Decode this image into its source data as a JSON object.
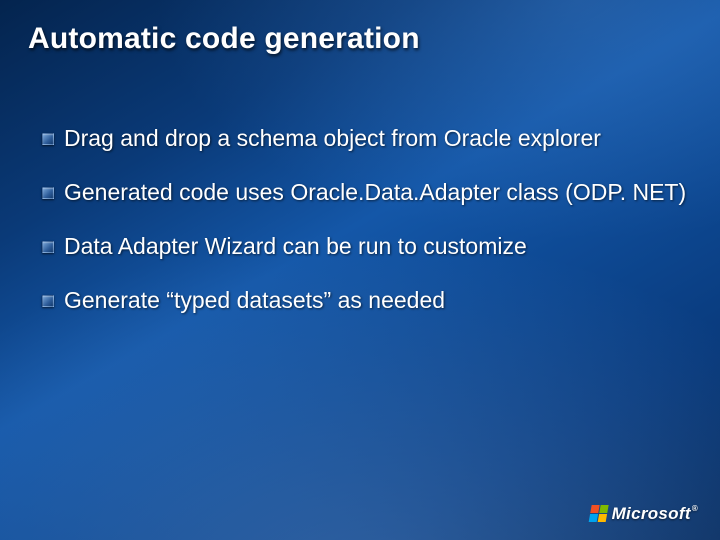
{
  "slide": {
    "title": "Automatic code generation",
    "bullets": [
      "Drag and drop a schema object from Oracle explorer",
      "Generated code uses Oracle.Data.Adapter class (ODP. NET)",
      "Data Adapter Wizard can be run to customize",
      "Generate “typed datasets” as needed"
    ]
  },
  "footer": {
    "logo_text": "Microsoft",
    "trademark": "®"
  }
}
